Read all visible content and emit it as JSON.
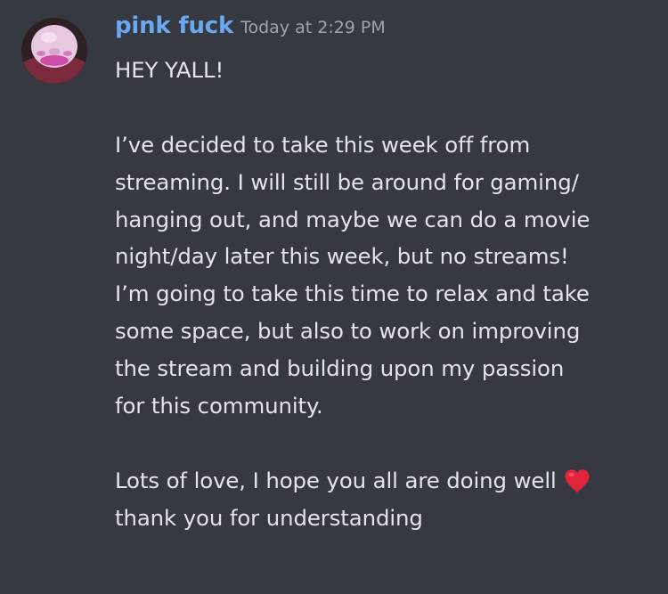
{
  "message": {
    "author": "pink fuck",
    "timestamp": "Today at 2:29 PM",
    "lines": {
      "l1": "HEY YALL!",
      "l2": "I’ve decided to take this week off from",
      "l3": "streaming. I will still be around for gaming/",
      "l4": "hanging out, and maybe we can do a movie",
      "l5": "night/day later this week, but no streams!",
      "l6": "I’m going to take this time to relax and take",
      "l7": "some space, but also to work on improving",
      "l8": "the stream and building upon my passion",
      "l9": "for this community.",
      "l10": "Lots of love, I hope you all are doing well",
      "l11": "thank you for understanding"
    },
    "emoji": "heart-emoji"
  },
  "colors": {
    "background": "#36393f",
    "username": "#6aa8f0",
    "timestamp": "#9fa4ab",
    "text": "#e3e5e8",
    "heart": "#e0243b"
  }
}
